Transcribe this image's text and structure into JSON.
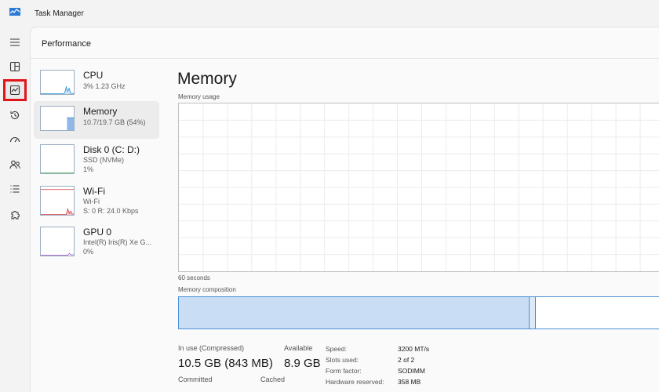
{
  "window": {
    "title": "Task Manager"
  },
  "nav": {
    "items": [
      {
        "name": "menu",
        "icon": "hamburger-menu-icon"
      },
      {
        "name": "processes",
        "icon": "processes-icon"
      },
      {
        "name": "performance",
        "icon": "performance-icon",
        "selected": true
      },
      {
        "name": "app-history",
        "icon": "history-icon"
      },
      {
        "name": "startup-apps",
        "icon": "startup-gauge-icon"
      },
      {
        "name": "users",
        "icon": "users-icon"
      },
      {
        "name": "details",
        "icon": "details-list-icon"
      },
      {
        "name": "services",
        "icon": "services-puzzle-icon"
      }
    ],
    "highlight_color": "#e0141b"
  },
  "header": {
    "title": "Performance"
  },
  "devices": [
    {
      "name": "CPU",
      "line1": "3% 1.23 GHz",
      "line2": ""
    },
    {
      "name": "Memory",
      "line1": "10.7/19.7 GB (54%)",
      "line2": "",
      "active": true
    },
    {
      "name": "Disk 0 (C: D:)",
      "line1": "SSD (NVMe)",
      "line2": "1%"
    },
    {
      "name": "Wi-Fi",
      "line1": "Wi-Fi",
      "line2": "S: 0 R: 24.0 Kbps"
    },
    {
      "name": "GPU 0",
      "line1": "Intel(R) Iris(R) Xe G...",
      "line2": "0%"
    }
  ],
  "memory": {
    "title": "Memory",
    "usage_label": "Memory usage",
    "time_label": "60 seconds",
    "composition_label": "Memory composition",
    "stats": {
      "in_use_label": "In use (Compressed)",
      "in_use_value": "10.5 GB (843 MB)",
      "available_label": "Available",
      "available_value": "8.9 GB",
      "committed_label": "Committed",
      "cached_label": "Cached"
    },
    "specs": [
      {
        "label": "Speed:",
        "value": "3200 MT/s"
      },
      {
        "label": "Slots used:",
        "value": "2 of 2"
      },
      {
        "label": "Form factor:",
        "value": "SODIMM"
      },
      {
        "label": "Hardware reserved:",
        "value": "358 MB"
      }
    ]
  },
  "colors": {
    "cpu": "#1f8fd6",
    "memory": "#8fb8e8",
    "wifi": "#d13438",
    "gpu": "#9b4fc9",
    "graph_border": "#4a90d9"
  }
}
